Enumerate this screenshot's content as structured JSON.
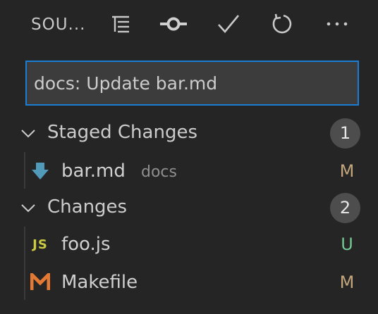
{
  "toolbar": {
    "title": "SOU...",
    "icons": [
      "tree-list-icon",
      "git-commit-icon",
      "checkmark-icon",
      "refresh-icon",
      "more-icon"
    ]
  },
  "commit_message": {
    "value": "docs: Update bar.md"
  },
  "groups": [
    {
      "label": "Staged Changes",
      "count": "1",
      "files": [
        {
          "name": "bar.md",
          "description": "docs",
          "status": "M",
          "icon": "markdown-download-icon",
          "status_color": "#c4a67c"
        }
      ]
    },
    {
      "label": "Changes",
      "count": "2",
      "files": [
        {
          "name": "foo.js",
          "description": "",
          "status": "U",
          "icon": "javascript-icon",
          "icon_text": "JS",
          "status_color": "#73c991"
        },
        {
          "name": "Makefile",
          "description": "",
          "status": "M",
          "icon": "makefile-icon",
          "status_color": "#c4a67c"
        }
      ]
    }
  ],
  "colors": {
    "background": "#252526",
    "input_border": "#1a7fd4",
    "badge": "#4d4d4d",
    "modified": "#c4a67c",
    "untracked": "#73c991",
    "markdown_icon": "#519aba",
    "makefile_icon": "#e37933",
    "js_icon": "#cbcb41"
  }
}
